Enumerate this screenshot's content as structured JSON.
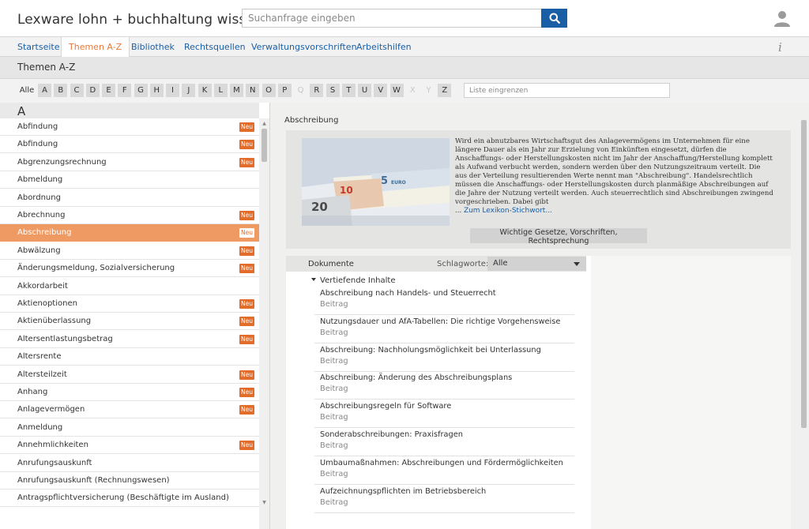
{
  "header": {
    "app_title": "Lexware lohn + buchhaltung wissen",
    "search_placeholder": "Suchanfrage eingeben"
  },
  "nav": {
    "tabs": [
      {
        "label": "Startseite"
      },
      {
        "label": "Themen A-Z",
        "active": true
      },
      {
        "label": "Bibliothek"
      },
      {
        "label": "Rechtsquellen"
      },
      {
        "label": "Verwaltungsvorschriften"
      },
      {
        "label": "Arbeitshilfen"
      }
    ],
    "info_glyph": "i"
  },
  "page": {
    "title": "Themen A-Z"
  },
  "alphabet": {
    "all_label": "Alle",
    "letters": [
      "A",
      "B",
      "C",
      "D",
      "E",
      "F",
      "G",
      "H",
      "I",
      "J",
      "K",
      "L",
      "M",
      "N",
      "O",
      "P",
      "Q",
      "R",
      "S",
      "T",
      "U",
      "V",
      "W",
      "X",
      "Y",
      "Z"
    ],
    "disabled": [
      "Q",
      "X",
      "Y"
    ],
    "filter_placeholder": "Liste eingrenzen"
  },
  "list": {
    "section_letter": "A",
    "new_badge": "Neu",
    "items": [
      {
        "label": "Abfindung",
        "new": true
      },
      {
        "label": "Abfindung",
        "new": true
      },
      {
        "label": "Abgrenzungsrechnung",
        "new": true
      },
      {
        "label": "Abmeldung",
        "new": false
      },
      {
        "label": "Abordnung",
        "new": false
      },
      {
        "label": "Abrechnung",
        "new": true
      },
      {
        "label": "Abschreibung",
        "new": true,
        "selected": true
      },
      {
        "label": "Abwälzung",
        "new": true
      },
      {
        "label": "Änderungsmeldung, Sozialversicherung",
        "new": true
      },
      {
        "label": "Akkordarbeit",
        "new": false
      },
      {
        "label": "Aktienoptionen",
        "new": true
      },
      {
        "label": "Aktienüberlassung",
        "new": true
      },
      {
        "label": "Altersentlastungsbetrag",
        "new": true
      },
      {
        "label": "Altersrente",
        "new": false
      },
      {
        "label": "Altersteilzeit",
        "new": true
      },
      {
        "label": "Anhang",
        "new": true
      },
      {
        "label": "Anlagevermögen",
        "new": true
      },
      {
        "label": "Anmeldung",
        "new": false
      },
      {
        "label": "Annehmlichkeiten",
        "new": true
      },
      {
        "label": "Anrufungsauskunft",
        "new": false
      },
      {
        "label": "Anrufungsauskunft (Rechnungswesen)",
        "new": false
      },
      {
        "label": "Antragspflichtversicherung (Beschäftigte im Ausland)",
        "new": false
      }
    ]
  },
  "content": {
    "title": "Abschreibung",
    "image_text": {
      "bill_10": "10",
      "bill_5": "5",
      "bill_5_word": "EURO",
      "bill_20": "20"
    },
    "teaser": "Wird ein abnutzbares Wirtschaftsgut des Anlagevermögens im Unternehmen für eine längere Dauer als ein Jahr zur Erzielung von Einkünften eingesetzt, dürfen die Anschaffungs- oder Herstellungskosten nicht im Jahr der Anschaffung/Herstellung komplett als Aufwand verbucht werden, sondern werden über den Nutzungszeitraum verteilt. Die aus der Verteilung resultierenden Werte nennt man \"Abschreibung\". Handelsrechtlich müssen die Anschaffungs- oder Herstellungskosten durch planmäßige Abschreibungen auf die Jahre der Nutzung verteilt werden. Auch steuerrechtlich sind Abschreibungen zwingend vorgeschrieben. Dabei gibt",
    "ellipsis": "...",
    "lexikon_link": "Zum Lexikon-Stichwort...",
    "laws_button": "Wichtige Gesetze, Vorschriften, Rechtsprechung"
  },
  "documents": {
    "header_label": "Dokumente",
    "tags_label": "Schlagworte:",
    "tags_value": "Alle",
    "group_label": "Vertiefende Inhalte",
    "items": [
      {
        "title": "Abschreibung nach Handels- und Steuerrecht",
        "type": "Beitrag"
      },
      {
        "title": "Nutzungsdauer und AfA-Tabellen: Die richtige Vorgehensweise",
        "type": "Beitrag"
      },
      {
        "title": "Abschreibung: Nachholungsmöglichkeit bei Unterlassung",
        "type": "Beitrag"
      },
      {
        "title": "Abschreibung: Änderung des Abschreibungsplans",
        "type": "Beitrag"
      },
      {
        "title": "Abschreibungsregeln für Software",
        "type": "Beitrag"
      },
      {
        "title": "Sonderabschreibungen: Praxisfragen",
        "type": "Beitrag"
      },
      {
        "title": "Umbaumaßnahmen: Abschreibungen und Fördermöglichkeiten",
        "type": "Beitrag"
      },
      {
        "title": "Aufzeichnungspflichten im Betriebsbereich",
        "type": "Beitrag"
      }
    ]
  },
  "icons": {
    "search": "search-icon",
    "user": "user-icon",
    "info": "info-icon",
    "expand": "caret-down-icon"
  },
  "colors": {
    "brand_blue": "#1a5fa5",
    "accent_orange": "#e9783a",
    "badge_orange": "#e46c2b",
    "selected_row": "#ef9a62"
  }
}
